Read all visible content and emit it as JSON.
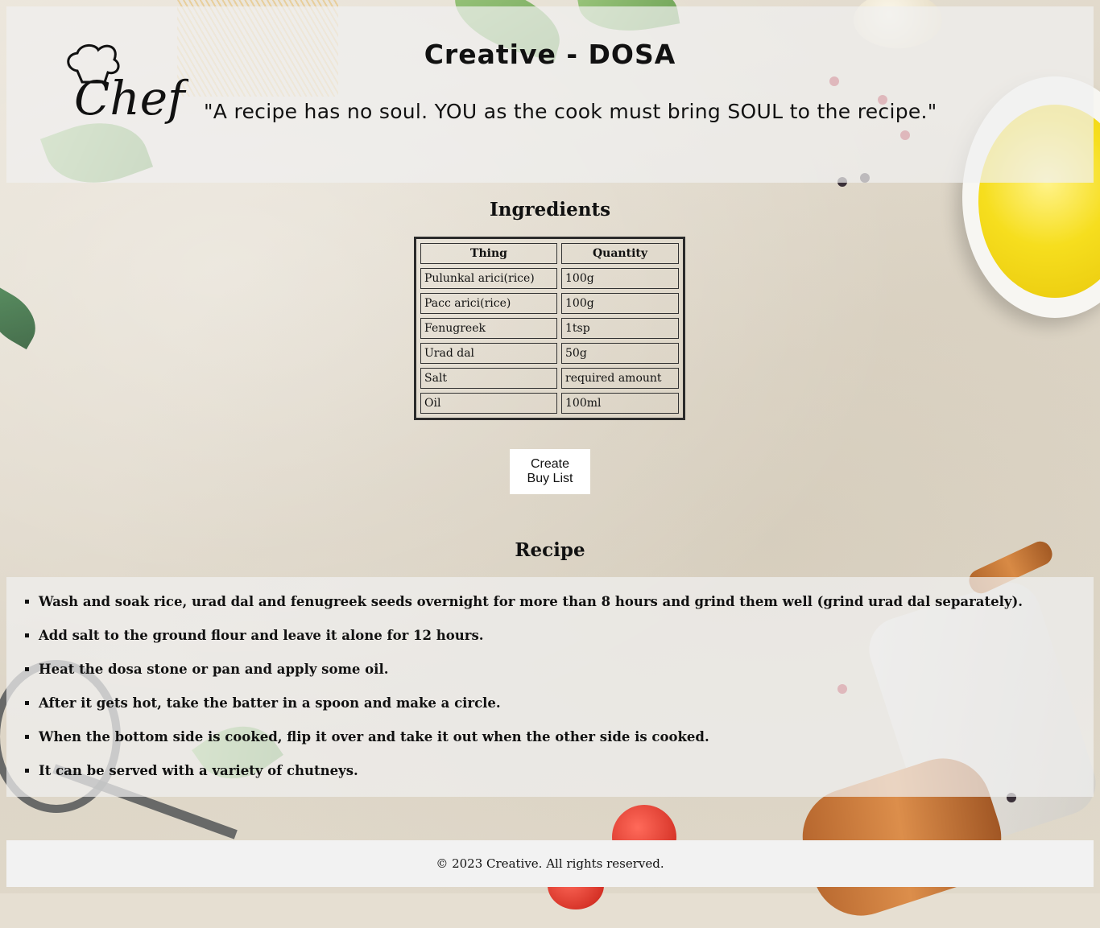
{
  "header": {
    "title": "Creative - DOSA",
    "quote": "\"A recipe has no soul. YOU as the cook must bring SOUL to the recipe.\"",
    "logo_text": "Chef"
  },
  "ingredients": {
    "heading": "Ingredients",
    "columns": [
      "Thing",
      "Quantity"
    ],
    "rows": [
      {
        "thing": "Pulunkal arici(rice)",
        "quantity": "100g"
      },
      {
        "thing": "Pacc arici(rice)",
        "quantity": "100g"
      },
      {
        "thing": "Fenugreek",
        "quantity": "1tsp"
      },
      {
        "thing": "Urad dal",
        "quantity": "50g"
      },
      {
        "thing": "Salt",
        "quantity": "required amount"
      },
      {
        "thing": "Oil",
        "quantity": "100ml"
      }
    ]
  },
  "buy_button": {
    "label": "Create Buy List"
  },
  "recipe": {
    "heading": "Recipe",
    "steps": [
      "Wash and soak rice, urad dal and fenugreek seeds overnight for more than 8 hours and grind them well (grind urad dal separately).",
      "Add salt to the ground flour and leave it alone for 12 hours.",
      "Heat the dosa stone or pan and apply some oil.",
      "After it gets hot, take the batter in a spoon and make a circle.",
      "When the bottom side is cooked, flip it over and take it out when the other side is cooked.",
      "It can be served with a variety of chutneys."
    ]
  },
  "footer": {
    "text": "© 2023 Creative. All rights reserved."
  },
  "icons": [
    "chef-hat-icon"
  ],
  "colors": {
    "panel": "#f0f0f0",
    "oil": "#f6de1e",
    "wood": "#c97a3a"
  }
}
